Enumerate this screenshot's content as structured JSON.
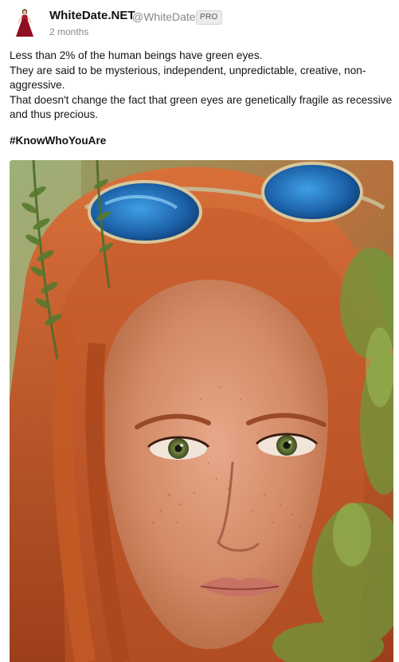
{
  "post": {
    "author_name": "WhiteDate.NET",
    "author_handle": "@WhiteDate",
    "badge": "PRO",
    "timestamp": "2 months",
    "paragraphs": [
      "Less than 2% of the human beings have green eyes.",
      "They are said to be mysterious, independent, unpredictable, creative, non-aggressive.",
      "That doesn't change the fact that green eyes are genetically fragile as recessive and thus precious."
    ],
    "hashtag": "#KnowWhoYouAre",
    "avatar_icon": "woman-in-red-dress-avatar",
    "image_icon": "portrait-redhead-green-eyes-photo"
  },
  "colors": {
    "text": "#141414",
    "muted": "#888888",
    "badge_bg": "#ececec"
  }
}
